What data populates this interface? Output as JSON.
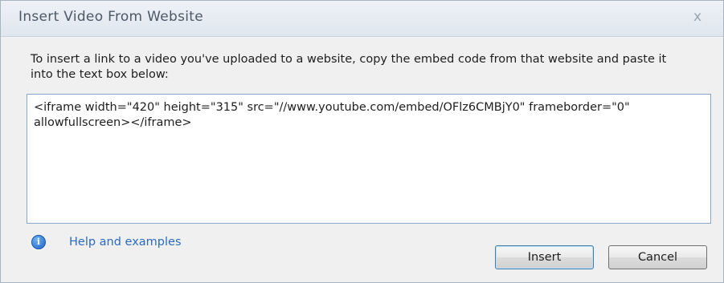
{
  "window": {
    "title": "Insert Video From Website",
    "close_symbol": "x"
  },
  "instructions": "To insert a link to a video you've uploaded to a website, copy the embed code from that website and paste it into the text box below:",
  "embed_code": {
    "value": "<iframe width=\"420\" height=\"315\" src=\"//www.youtube.com/embed/OFlz6CMBjY0\" frameborder=\"0\" allowfullscreen></iframe>"
  },
  "help": {
    "label": "Help and examples",
    "icon": "info-icon",
    "icon_glyph": "i"
  },
  "buttons": {
    "insert_label": "Insert",
    "cancel_label": "Cancel"
  },
  "colors": {
    "link": "#2b6bbf",
    "focus_border": "#3c7fb1"
  }
}
